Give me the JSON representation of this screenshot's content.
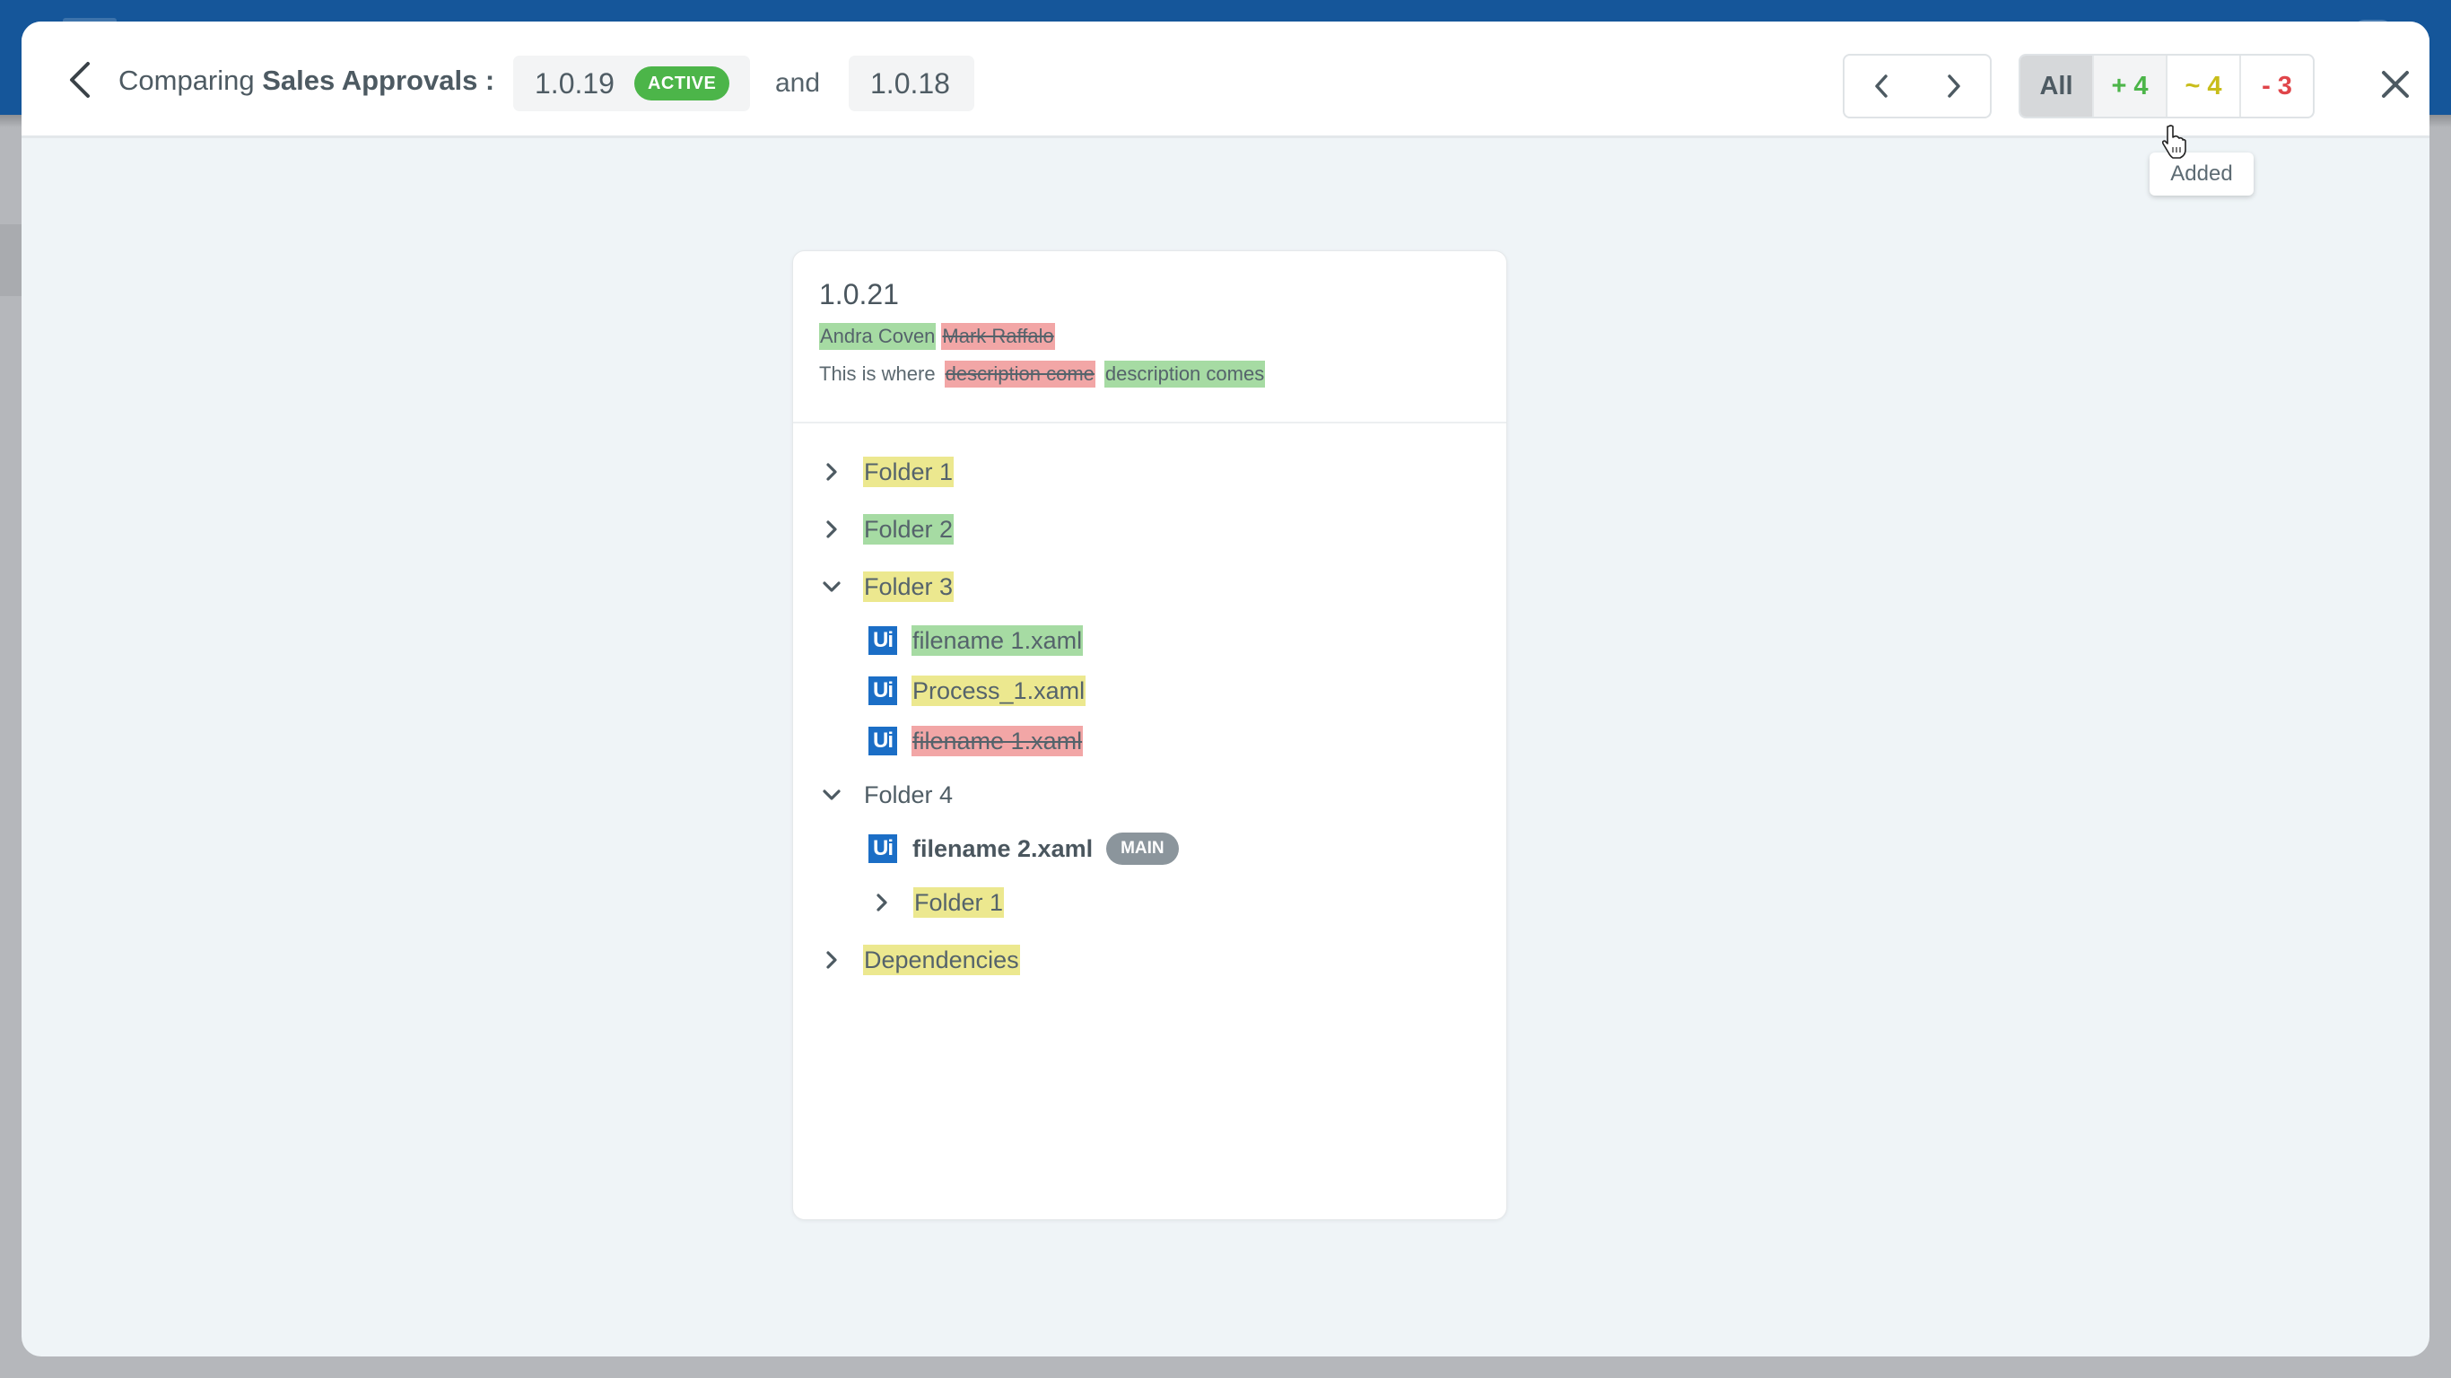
{
  "header": {
    "title_prefix": "Comparing",
    "title_subject": "Sales Approvals :",
    "version_a": "1.0.19",
    "version_a_badge": "ACTIVE",
    "conjunction": "and",
    "version_b": "1.0.18"
  },
  "filters": {
    "all": "All",
    "added": "+ 4",
    "modified": "~ 4",
    "removed": "- 3",
    "tooltip": "Added"
  },
  "colors": {
    "brand_topbar": "#15569a",
    "active_badge": "#4cb549",
    "added_highlight": "#a6dba3",
    "removed_highlight": "#f2a6a6",
    "modified_highlight": "#ece88f",
    "added_text": "#4cb549",
    "modified_text": "#c8bd1a",
    "removed_text": "#e0454a",
    "ui_icon": "#1b6ec6"
  },
  "card": {
    "version": "1.0.21",
    "author_added": "Andra Coven",
    "author_removed": "Mark Raffalo",
    "description_prefix": "This is where",
    "description_removed": "description come",
    "description_added": "description comes"
  },
  "tree": {
    "folder1": {
      "label": "Folder 1",
      "state": "modified",
      "expanded": false
    },
    "folder2": {
      "label": "Folder 2",
      "state": "added",
      "expanded": false
    },
    "folder3": {
      "label": "Folder 3",
      "state": "modified",
      "expanded": true,
      "children": [
        {
          "icon": "Ui",
          "label": "filename 1.xaml",
          "state": "added"
        },
        {
          "icon": "Ui",
          "label": "Process_1.xaml",
          "state": "modified"
        },
        {
          "icon": "Ui",
          "label": "filename 1.xaml",
          "state": "removed"
        }
      ]
    },
    "folder4": {
      "label": "Folder 4",
      "state": "unchanged",
      "expanded": true,
      "children": [
        {
          "icon": "Ui",
          "label": "filename 2.xaml",
          "state": "unchanged",
          "badge": "MAIN"
        },
        {
          "label": "Folder 1",
          "state": "modified",
          "expanded": false
        }
      ]
    },
    "dependencies": {
      "label": "Dependencies",
      "state": "modified",
      "expanded": false
    }
  }
}
